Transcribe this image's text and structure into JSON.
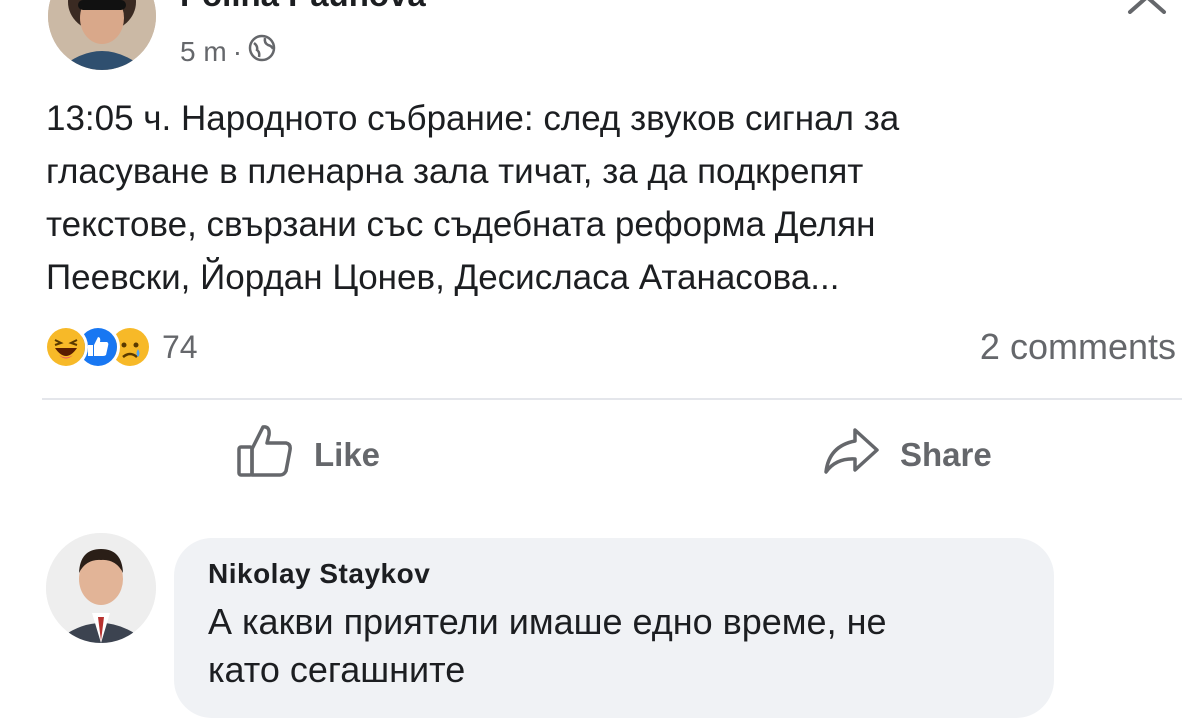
{
  "post": {
    "author_name": "Polina Paunova",
    "timestamp": "5 m",
    "separator": "·",
    "audience_icon": "globe-icon",
    "text_lines": [
      "13:05 ч. Народното събрание: след звуков сигнал за",
      "гласуване в пленарна зала тичат, за да подкрепят",
      "текстове, свързани със съдебната реформа Делян",
      "Пеевски, Йордан Цонев, Десисласа Атанасова..."
    ],
    "reactions": {
      "icons": [
        "haha-icon",
        "like-icon",
        "sad-icon"
      ],
      "count": "74"
    },
    "comments_count_label": "2 comments"
  },
  "actions": {
    "like_label": "Like",
    "share_label": "Share"
  },
  "comment": {
    "author": "Nikolay Staykov",
    "text_lines": [
      "А какви приятели имаше едно време, не",
      "като сегашните"
    ]
  },
  "colors": {
    "text_primary": "#1c1e21",
    "text_secondary": "#65676b",
    "like_blue": "#1877f2",
    "reaction_yellow": "#f7b928",
    "bubble_bg": "#f0f2f5",
    "divider": "#e4e6eb"
  }
}
